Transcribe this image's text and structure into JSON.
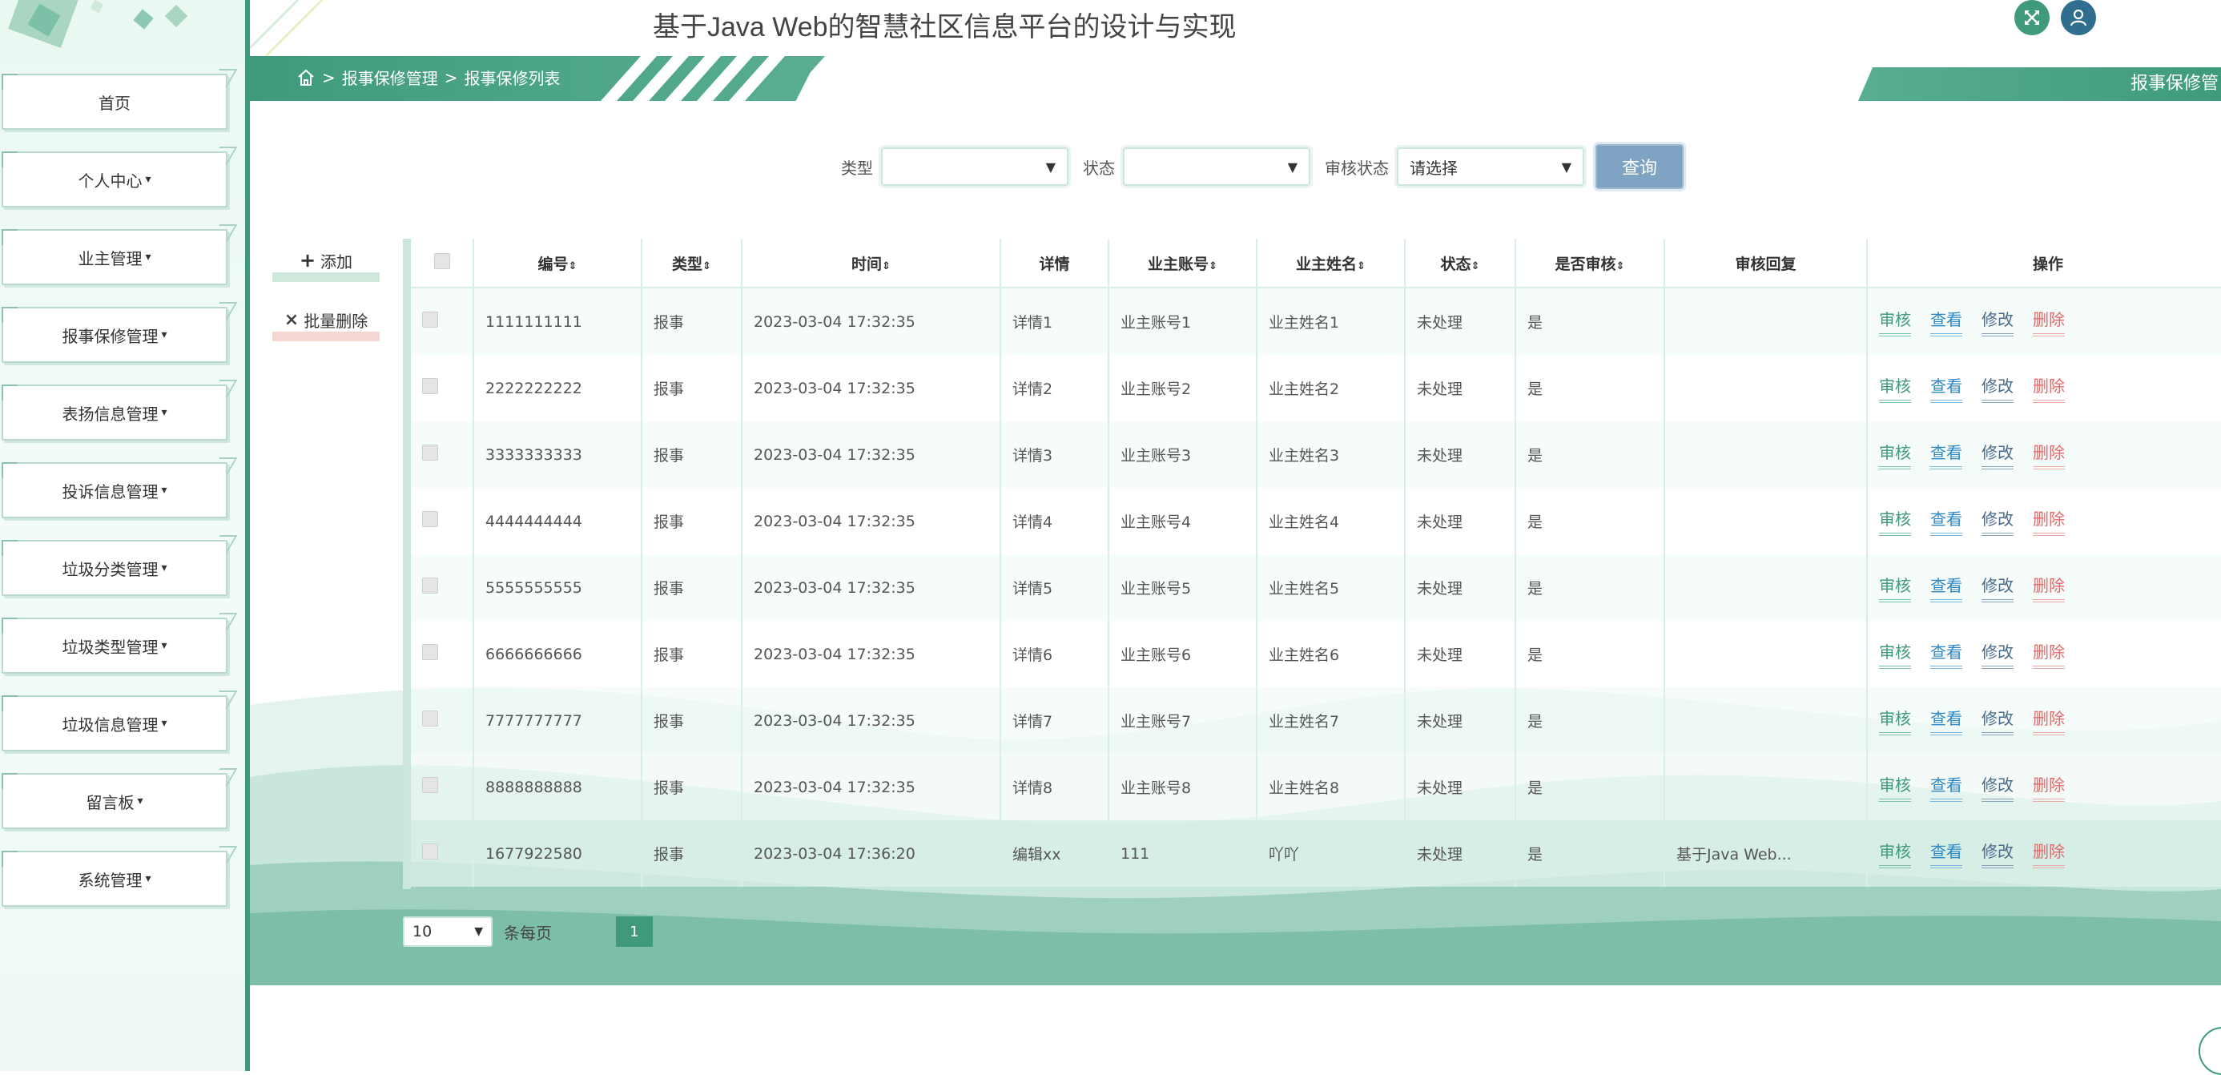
{
  "header": {
    "title": "基于Java Web的智慧社区信息平台的设计与实现",
    "fullscreen_icon": "expand-icon",
    "user_icon": "user-icon"
  },
  "breadcrumb": {
    "sep1": ">",
    "level1": "报事保修管理",
    "sep2": ">",
    "level2": "报事保修列表"
  },
  "right_tag": "报事保修管",
  "sidebar": {
    "items": [
      {
        "label": "首页",
        "caret": ""
      },
      {
        "label": "个人中心",
        "caret": "▾"
      },
      {
        "label": "业主管理",
        "caret": "▾"
      },
      {
        "label": "报事保修管理",
        "caret": "▾"
      },
      {
        "label": "表扬信息管理",
        "caret": "▾"
      },
      {
        "label": "投诉信息管理",
        "caret": "▾"
      },
      {
        "label": "垃圾分类管理",
        "caret": "▾"
      },
      {
        "label": "垃圾类型管理",
        "caret": "▾"
      },
      {
        "label": "垃圾信息管理",
        "caret": "▾"
      },
      {
        "label": "留言板",
        "caret": "▾"
      },
      {
        "label": "系统管理",
        "caret": "▾"
      }
    ]
  },
  "search": {
    "type_label": "类型",
    "type_value": "",
    "status_label": "状态",
    "status_value": "",
    "audit_label": "审核状态",
    "audit_value": "请选择",
    "query_button": "查询"
  },
  "actions": {
    "add": "添加",
    "add_icon": "+",
    "batch_delete": "批量删除",
    "batch_delete_icon": "×"
  },
  "table": {
    "headers": {
      "id": "编号",
      "type": "类型",
      "time": "时间",
      "detail": "详情",
      "account": "业主账号",
      "name": "业主姓名",
      "status": "状态",
      "audited": "是否审核",
      "reply": "审核回复",
      "ops": "操作"
    },
    "sort_glyph": "⇕",
    "op_labels": {
      "audit": "审核",
      "view": "查看",
      "edit": "修改",
      "delete": "删除"
    },
    "rows": [
      {
        "id": "1111111111",
        "type": "报事",
        "time": "2023-03-04 17:32:35",
        "detail": "详情1",
        "account": "业主账号1",
        "name": "业主姓名1",
        "status": "未处理",
        "audited": "是",
        "reply": ""
      },
      {
        "id": "2222222222",
        "type": "报事",
        "time": "2023-03-04 17:32:35",
        "detail": "详情2",
        "account": "业主账号2",
        "name": "业主姓名2",
        "status": "未处理",
        "audited": "是",
        "reply": ""
      },
      {
        "id": "3333333333",
        "type": "报事",
        "time": "2023-03-04 17:32:35",
        "detail": "详情3",
        "account": "业主账号3",
        "name": "业主姓名3",
        "status": "未处理",
        "audited": "是",
        "reply": ""
      },
      {
        "id": "4444444444",
        "type": "报事",
        "time": "2023-03-04 17:32:35",
        "detail": "详情4",
        "account": "业主账号4",
        "name": "业主姓名4",
        "status": "未处理",
        "audited": "是",
        "reply": ""
      },
      {
        "id": "5555555555",
        "type": "报事",
        "time": "2023-03-04 17:32:35",
        "detail": "详情5",
        "account": "业主账号5",
        "name": "业主姓名5",
        "status": "未处理",
        "audited": "是",
        "reply": ""
      },
      {
        "id": "6666666666",
        "type": "报事",
        "time": "2023-03-04 17:32:35",
        "detail": "详情6",
        "account": "业主账号6",
        "name": "业主姓名6",
        "status": "未处理",
        "audited": "是",
        "reply": ""
      },
      {
        "id": "7777777777",
        "type": "报事",
        "time": "2023-03-04 17:32:35",
        "detail": "详情7",
        "account": "业主账号7",
        "name": "业主姓名7",
        "status": "未处理",
        "audited": "是",
        "reply": ""
      },
      {
        "id": "8888888888",
        "type": "报事",
        "time": "2023-03-04 17:32:35",
        "detail": "详情8",
        "account": "业主账号8",
        "name": "业主姓名8",
        "status": "未处理",
        "audited": "是",
        "reply": ""
      },
      {
        "id": "1677922580",
        "type": "报事",
        "time": "2023-03-04 17:36:20",
        "detail": "编辑xx",
        "account": "111",
        "name": "吖吖",
        "status": "未处理",
        "audited": "是",
        "reply": "基于Java Web..."
      }
    ]
  },
  "pagination": {
    "page_size": "10",
    "per_page_label": "条每页",
    "current_page": "1"
  },
  "colors": {
    "primary": "#3f9a7c",
    "query_button": "#7fa3c2",
    "delete_accent": "#e06a6a"
  }
}
